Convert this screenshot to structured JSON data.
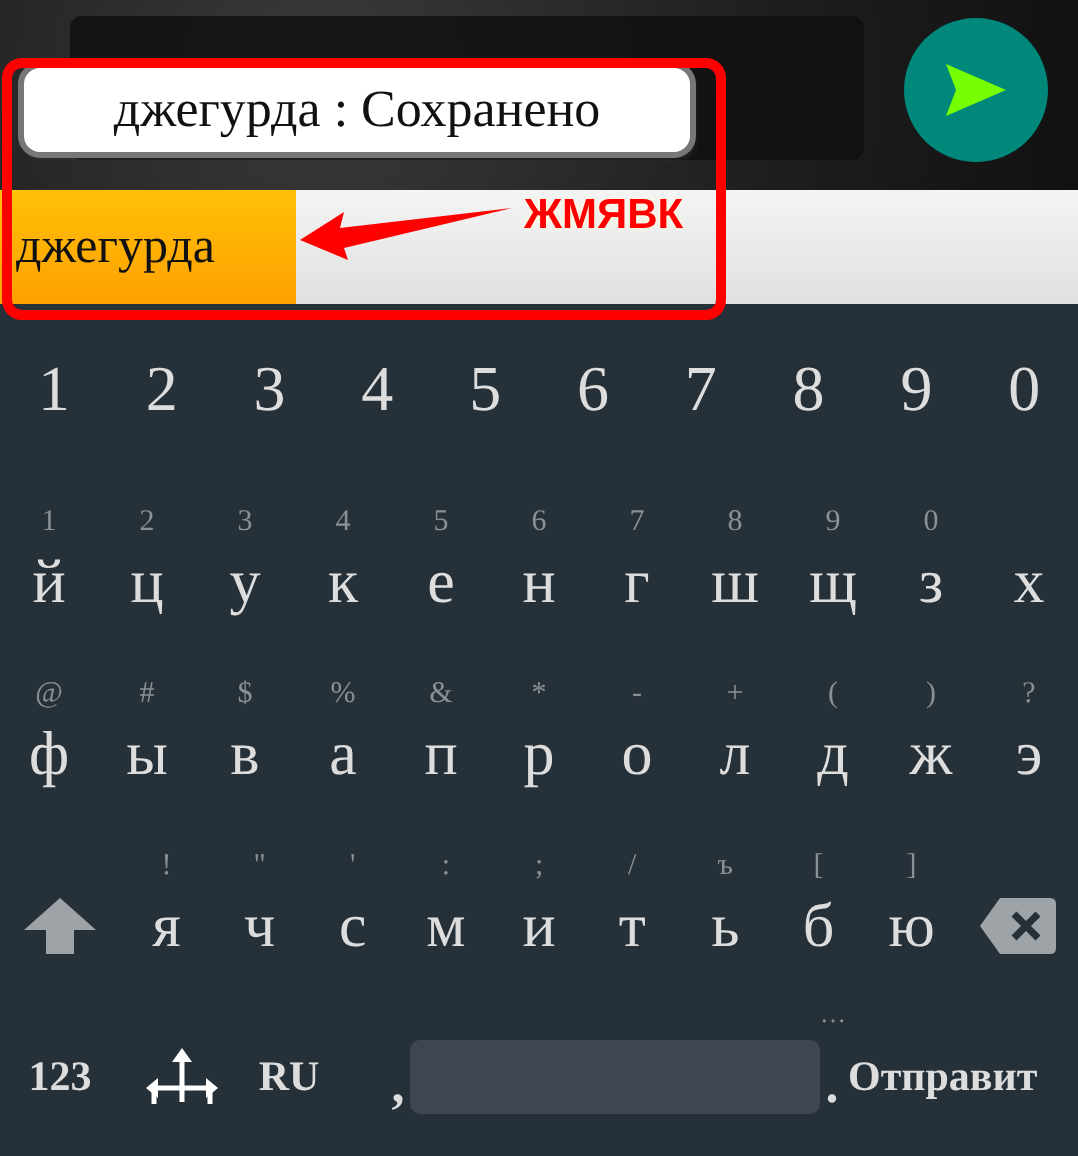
{
  "toast": {
    "text": "джегурда : Сохранено"
  },
  "suggestions": [
    {
      "text": "джегурда",
      "selected": true
    }
  ],
  "annotation": {
    "label": "ЖМЯВК"
  },
  "keyboard": {
    "number_row": [
      "1",
      "2",
      "3",
      "4",
      "5",
      "6",
      "7",
      "8",
      "9",
      "0"
    ],
    "letter_rows": [
      {
        "keys": [
          {
            "label": "й",
            "hint": "1"
          },
          {
            "label": "ц",
            "hint": "2"
          },
          {
            "label": "у",
            "hint": "3"
          },
          {
            "label": "к",
            "hint": "4"
          },
          {
            "label": "е",
            "hint": "5"
          },
          {
            "label": "н",
            "hint": "6"
          },
          {
            "label": "г",
            "hint": "7"
          },
          {
            "label": "ш",
            "hint": "8"
          },
          {
            "label": "щ",
            "hint": "9"
          },
          {
            "label": "з",
            "hint": "0"
          },
          {
            "label": "х"
          }
        ]
      },
      {
        "keys": [
          {
            "label": "ф",
            "hint": "@"
          },
          {
            "label": "ы",
            "hint": "#"
          },
          {
            "label": "в",
            "hint": "$"
          },
          {
            "label": "а",
            "hint": "%"
          },
          {
            "label": "п",
            "hint": "&"
          },
          {
            "label": "р",
            "hint": "*"
          },
          {
            "label": "о",
            "hint": "-"
          },
          {
            "label": "л",
            "hint": "+"
          },
          {
            "label": "д",
            "hint": "("
          },
          {
            "label": "ж",
            "hint": ")"
          },
          {
            "label": "э",
            "hint": "?"
          }
        ]
      },
      {
        "keys": [
          {
            "label": "я",
            "hint": "!"
          },
          {
            "label": "ч",
            "hint": "\""
          },
          {
            "label": "с",
            "hint": "'"
          },
          {
            "label": "м",
            "hint": ":"
          },
          {
            "label": "и",
            "hint": ";"
          },
          {
            "label": "т",
            "hint": "/"
          },
          {
            "label": "ь",
            "hint": "ъ"
          },
          {
            "label": "б",
            "hint": "["
          },
          {
            "label": "ю",
            "hint": "]"
          }
        ]
      }
    ],
    "bottom_row": {
      "symbols_key": "123",
      "language_key": "RU",
      "comma": ",",
      "period": ".",
      "period_hint": "…",
      "action_key": "Отправит"
    }
  }
}
